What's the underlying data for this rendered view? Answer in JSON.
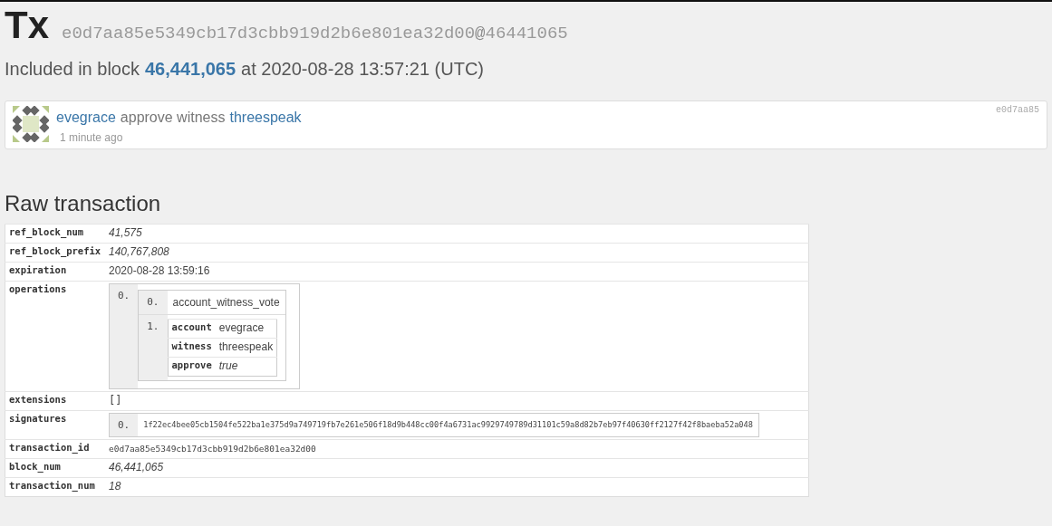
{
  "header": {
    "title": "Tx",
    "tx_hash": "e0d7aa85e5349cb17d3cbb919d2b6e801ea32d00",
    "at_sign": "@",
    "block": "46441065"
  },
  "included": {
    "prefix": "Included in block",
    "block": "46,441,065",
    "suffix": "at 2020-08-28 13:57:21 (UTC)"
  },
  "operation_card": {
    "account": "evegrace",
    "action": "approve witness",
    "target": "threespeak",
    "time": "1 minute ago",
    "short_id": "e0d7aa85"
  },
  "raw_heading": "Raw transaction",
  "rows": [
    {
      "key": "ref_block_num",
      "kind": "number",
      "value": "41,575"
    },
    {
      "key": "ref_block_prefix",
      "kind": "number",
      "value": "140,767,808"
    },
    {
      "key": "expiration",
      "kind": "text",
      "value": "2020-08-28 13:59:16"
    },
    {
      "key": "operations",
      "kind": "operations",
      "index": "0.",
      "op_index": "0.",
      "op_name": "account_witness_vote",
      "params_index": "1.",
      "params": [
        {
          "key": "account",
          "kind": "text",
          "value": "evegrace"
        },
        {
          "key": "witness",
          "kind": "text",
          "value": "threespeak"
        },
        {
          "key": "approve",
          "kind": "number",
          "value": "true"
        }
      ]
    },
    {
      "key": "extensions",
      "kind": "code",
      "value": "[]"
    },
    {
      "key": "signatures",
      "kind": "signatures",
      "index": "0.",
      "value": "1f22ec4bee05cb1504fe522ba1e375d9a749719fb7e261e506f18d9b448cc00f4a6731ac9929749789d31101c59a8d82b7eb97f40630ff2127f42f8baeba52a048"
    },
    {
      "key": "transaction_id",
      "kind": "hash",
      "value": "e0d7aa85e5349cb17d3cbb919d2b6e801ea32d00"
    },
    {
      "key": "block_num",
      "kind": "number",
      "value": "46,441,065"
    },
    {
      "key": "transaction_num",
      "kind": "number",
      "value": "18"
    }
  ]
}
